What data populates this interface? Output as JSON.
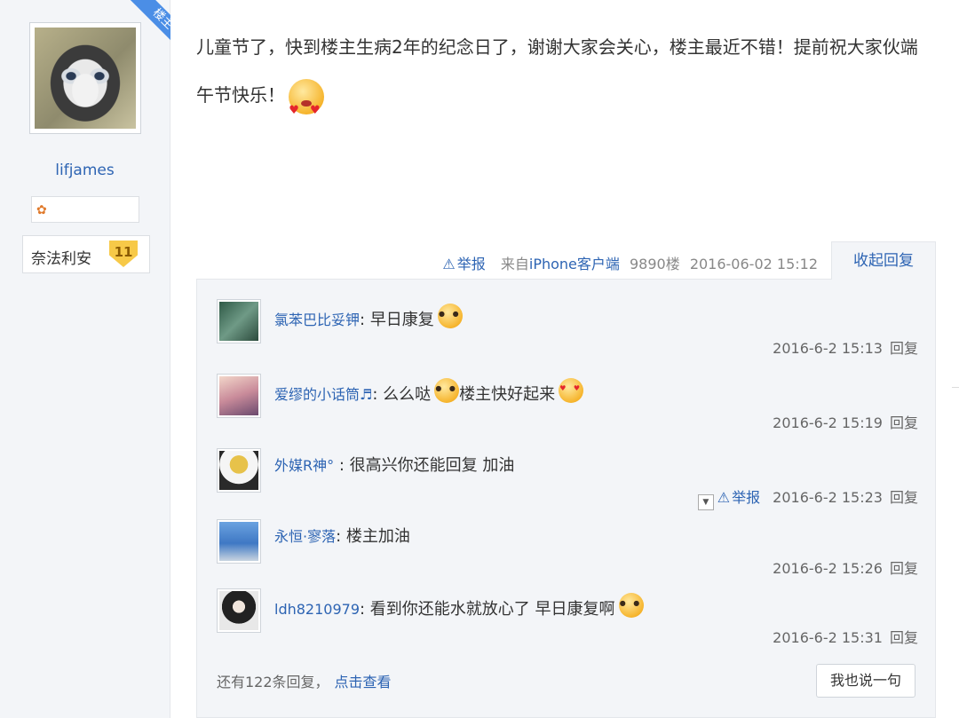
{
  "sidebar": {
    "ribbon": "楼主",
    "username": "lifjames",
    "level_name": "奈法利安",
    "level_num": "11"
  },
  "post": {
    "text": "儿童节了，快到楼主生病2年的纪念日了，谢谢大家会关心，楼主最近不错！提前祝大家伙端午节快乐！",
    "report": "举报",
    "source_prefix": "来自",
    "source_client": "iPhone客户端",
    "floor": "9890楼",
    "time": "2016-06-02 15:12",
    "collapse": "收起回复"
  },
  "replies": [
    {
      "name": "氯苯巴比妥钾",
      "text": "早日康复",
      "time": "2016-6-2 15:13",
      "reply": "回复"
    },
    {
      "name": "爱缪的小话筒♬",
      "text": "么么哒",
      "text2": "楼主快好起来",
      "time": "2016-6-2 15:19",
      "reply": "回复"
    },
    {
      "name": "外媒R神°",
      "text": "很高兴你还能回复 加油",
      "time": "2016-6-2 15:23",
      "reply": "回复",
      "report": "举报"
    },
    {
      "name": "永恒·寥落",
      "text": "楼主加油",
      "time": "2016-6-2 15:26",
      "reply": "回复"
    },
    {
      "name": "ldh8210979",
      "text": "看到你还能水就放心了 早日康复啊",
      "time": "2016-6-2 15:31",
      "reply": "回复"
    }
  ],
  "footer": {
    "more_text": "还有122条回复，",
    "more_link": "点击查看",
    "say_button": "我也说一句"
  },
  "colors": {
    "link": "#2d64b3",
    "panel": "#f3f5f8",
    "ribbon": "#4b8ee6"
  }
}
